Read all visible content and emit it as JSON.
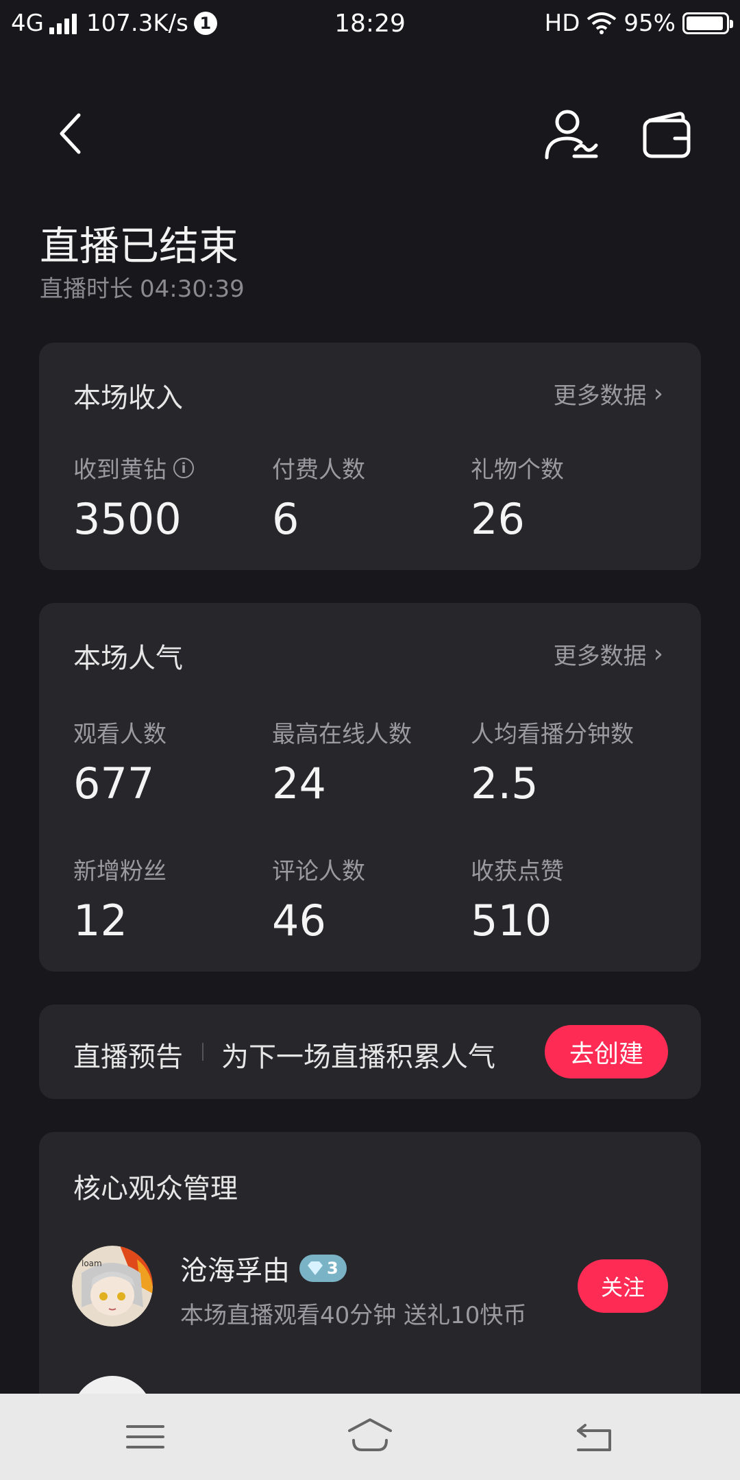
{
  "status_bar": {
    "network": "4G",
    "speed": "107.3K/s",
    "notification_count": "1",
    "time": "18:29",
    "hd": "HD",
    "battery": "95%"
  },
  "header": {
    "title": "直播已结束",
    "duration_label": "直播时长",
    "duration_value": "04:30:39"
  },
  "income": {
    "title": "本场收入",
    "more": "更多数据",
    "stats": [
      {
        "label": "收到黄钻",
        "value": "3500"
      },
      {
        "label": "付费人数",
        "value": "6"
      },
      {
        "label": "礼物个数",
        "value": "26"
      }
    ]
  },
  "popularity": {
    "title": "本场人气",
    "more": "更多数据",
    "stats": [
      {
        "label": "观看人数",
        "value": "677"
      },
      {
        "label": "最高在线人数",
        "value": "24"
      },
      {
        "label": "人均看播分钟数",
        "value": "2.5"
      },
      {
        "label": "新增粉丝",
        "value": "12"
      },
      {
        "label": "评论人数",
        "value": "46"
      },
      {
        "label": "收获点赞",
        "value": "510"
      }
    ]
  },
  "preview": {
    "label": "直播预告",
    "desc": "为下一场直播积累人气",
    "button": "去创建"
  },
  "core_audience": {
    "title": "核心观众管理",
    "viewers": [
      {
        "name": "沧海孚由",
        "level": "3",
        "desc": "本场直播观看40分钟 送礼10快币",
        "button": "关注"
      }
    ]
  },
  "colors": {
    "accent": "#fe2c55",
    "background": "#17171c",
    "card": "#26262b"
  }
}
